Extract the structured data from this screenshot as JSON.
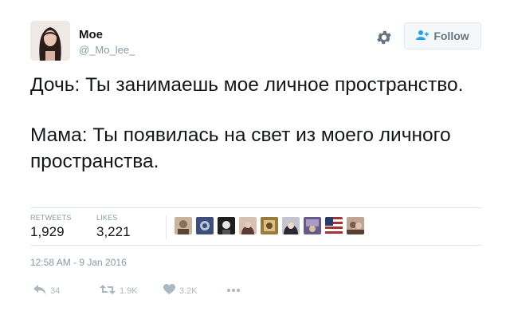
{
  "user": {
    "display_name": "Moe",
    "handle": "@_Mo_lee_"
  },
  "header": {
    "follow_label": "Follow"
  },
  "tweet": {
    "lines": [
      "Дочь: Ты занимаешь мое личное пространство.",
      "Мама: Ты появилась на свет из моего личного пространства."
    ],
    "timestamp": "12:58 AM - 9 Jan 2016"
  },
  "stats": {
    "retweets_label": "RETWEETS",
    "retweets": "1,929",
    "likes_label": "LIKES",
    "likes": "3,221"
  },
  "likers": [
    {
      "name": "liker-1",
      "color": "#8a6f5c"
    },
    {
      "name": "liker-2",
      "color": "#3b4f7a"
    },
    {
      "name": "liker-3",
      "color": "#1f1f1f"
    },
    {
      "name": "liker-4",
      "color": "#5c3a3a"
    },
    {
      "name": "liker-5",
      "color": "#9a7a3a"
    },
    {
      "name": "liker-6",
      "color": "#2a2a35"
    },
    {
      "name": "liker-7",
      "color": "#6a5a8a"
    },
    {
      "name": "liker-8",
      "color": "#a83232"
    },
    {
      "name": "liker-9",
      "color": "#7a5a4a"
    }
  ],
  "actions": {
    "reply_count": "34",
    "retweet_count": "1.9K",
    "like_count": "3.2K"
  },
  "icons": {
    "gear": "gear-icon",
    "follow": "follow-user-icon",
    "reply": "reply-icon",
    "retweet": "retweet-icon",
    "like": "heart-icon",
    "more": "more-icon"
  },
  "colors": {
    "text": "#14171a",
    "muted": "#8899a6",
    "action_gray": "#aab8c2",
    "border": "#e1e8ed",
    "follow_accent": "#1da1f2"
  }
}
